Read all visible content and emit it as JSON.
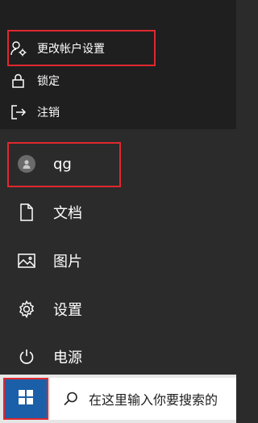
{
  "account_flyout": {
    "change_settings_label": "更改帐户设置",
    "lock_label": "锁定",
    "signout_label": "注销"
  },
  "start_menu": {
    "user_name": "qg",
    "documents_label": "文档",
    "pictures_label": "图片",
    "settings_label": "设置",
    "power_label": "电源"
  },
  "taskbar": {
    "search_placeholder": "在这里输入你要搜索的"
  },
  "colors": {
    "highlight_border": "#e0282e",
    "start_button_bg": "#1a5fa8"
  },
  "icons": [
    "user-settings-icon",
    "lock-icon",
    "signout-icon",
    "avatar-icon",
    "document-icon",
    "pictures-icon",
    "settings-gear-icon",
    "power-icon",
    "windows-logo-icon",
    "search-icon"
  ]
}
